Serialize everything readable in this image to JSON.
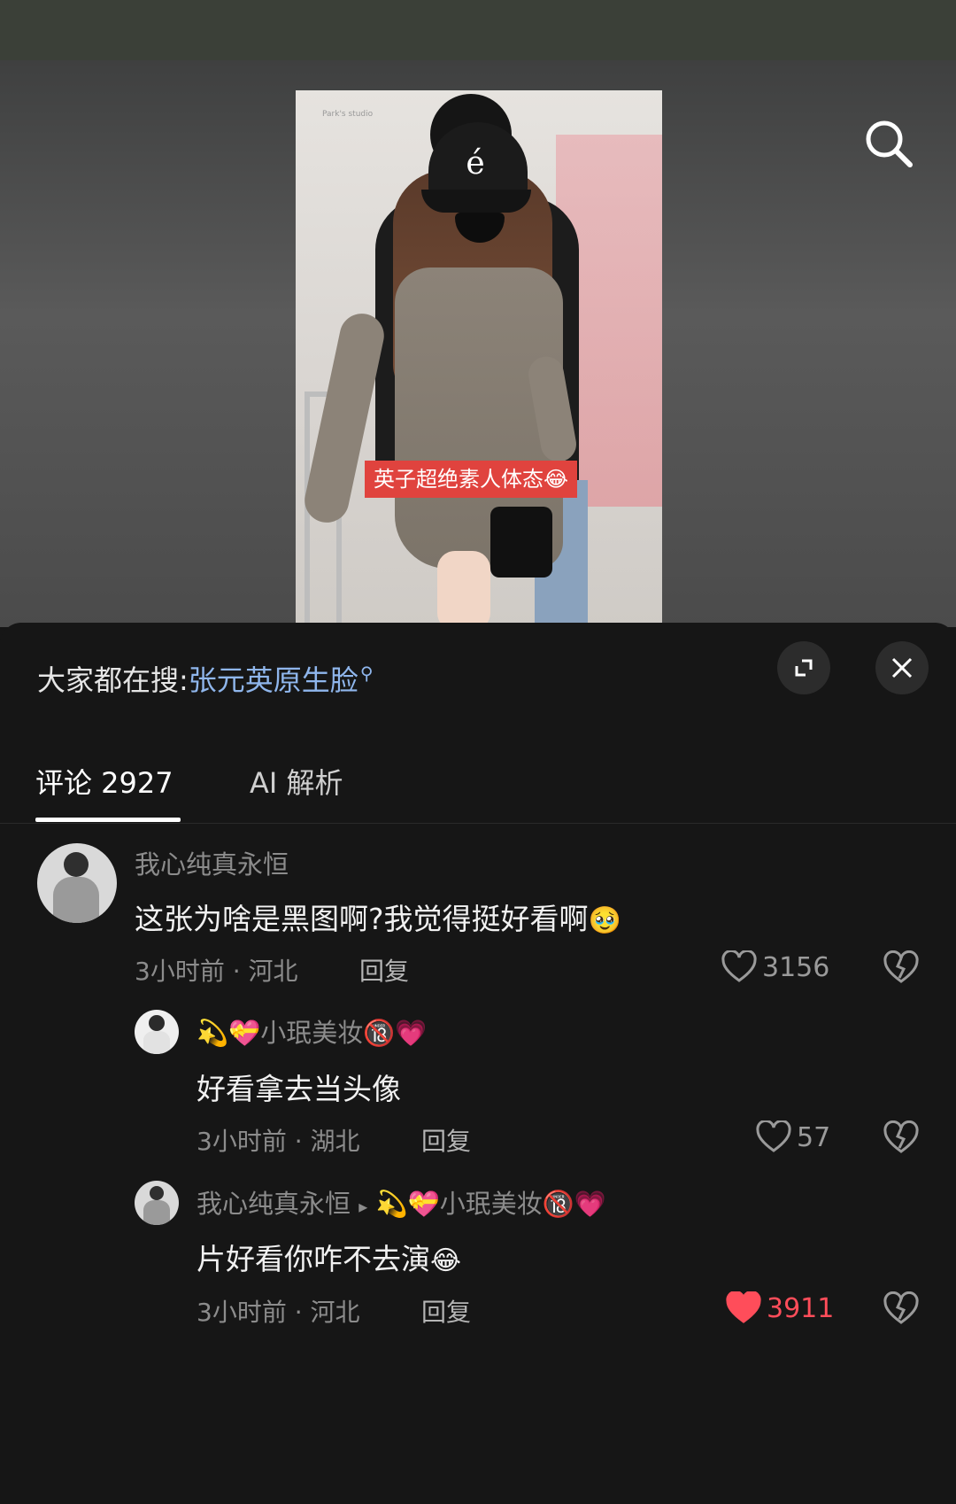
{
  "video": {
    "caption": "英子超绝素人体态😂",
    "watermark": "Park's studio"
  },
  "panel": {
    "hot_search_label": "大家都在搜:",
    "hot_search_term": "张元英原生脸",
    "tabs": [
      {
        "label": "评论 2927",
        "active": true
      },
      {
        "label": "AI 解析",
        "active": false
      }
    ]
  },
  "comments": [
    {
      "username": "我心纯真永恒",
      "text": "这张为啥是黑图啊?我觉得挺好看啊",
      "text_emoji": "🥹",
      "meta": "3小时前 · 河北",
      "reply_label": "回复",
      "likes": "3156",
      "liked": false
    },
    {
      "username_prefix": "💫💝",
      "username": "小珉美妆",
      "username_suffix": "🔞💗",
      "text": "好看拿去当头像",
      "meta": "3小时前 · 湖北",
      "reply_label": "回复",
      "likes": "57",
      "liked": false
    },
    {
      "username": "我心纯真永恒",
      "reply_arrow": "▸",
      "reply_to_prefix": "💫💝",
      "reply_to": "小珉美妆",
      "reply_to_suffix": "🔞💗",
      "text": "片好看你咋不去演",
      "text_emoji": "😂",
      "meta": "3小时前 · 河北",
      "reply_label": "回复",
      "likes": "3911",
      "liked": true
    }
  ],
  "colors": {
    "accent_link": "#8fb6ec",
    "like_active": "#ff4d5a",
    "caption_bg": "#e0433e"
  },
  "icons": [
    "search-icon",
    "expand-icon",
    "close-icon",
    "heart-icon",
    "dislike-icon"
  ]
}
